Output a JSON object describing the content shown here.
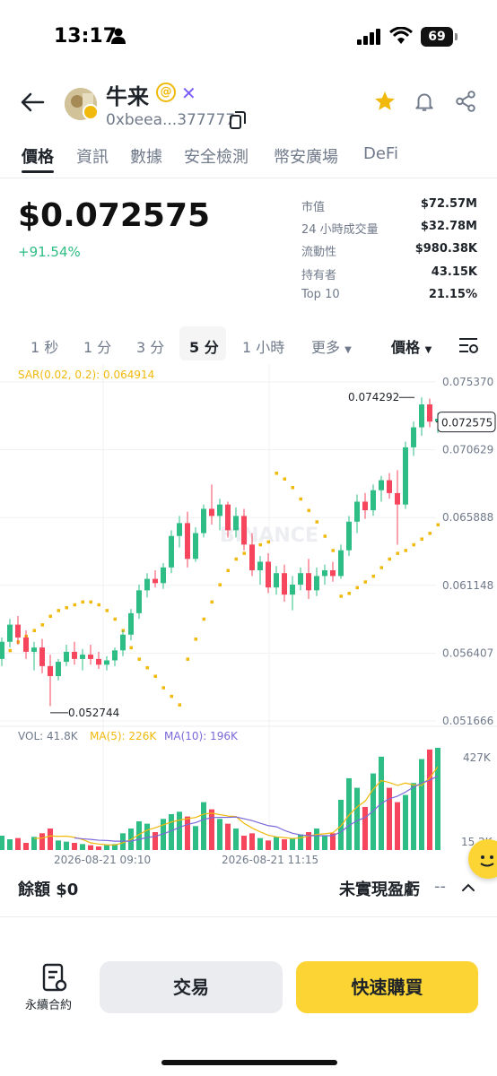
{
  "status_bar": {
    "time": "13:17",
    "battery": "69"
  },
  "token": {
    "name": "牛来",
    "address": "0xbeea...377777"
  },
  "tabs": [
    "價格",
    "資訊",
    "數據",
    "安全檢測",
    "幣安廣場",
    "DeFi"
  ],
  "price": {
    "value": "$0.072575",
    "change": "+91.54%"
  },
  "stats": [
    {
      "label": "市值",
      "value": "$72.57M"
    },
    {
      "label": "24 小時成交量",
      "value": "$32.78M"
    },
    {
      "label": "流動性",
      "value": "$980.38K"
    },
    {
      "label": "持有者",
      "value": "43.15K"
    },
    {
      "label": "Top 10",
      "value": "21.15%"
    }
  ],
  "timeframes": [
    "1 秒",
    "1 分",
    "3 分",
    "5 分",
    "1 小時",
    "更多"
  ],
  "active_timeframe": "5 分",
  "chart_type_label": "價格",
  "chart_data": {
    "type": "candlestick",
    "indicator_label": "SAR(0.02, 0.2): 0.064914",
    "y_ticks": [
      "0.075370",
      "0.070629",
      "0.065888",
      "0.061148",
      "0.056407",
      "0.051666"
    ],
    "ylim": [
      0.051666,
      0.07537
    ],
    "current_price": "0.072575",
    "high_label": "0.074292",
    "low_label": "0.052744",
    "watermark": "BINANCE",
    "volume_labels": {
      "vol": "VOL: 41.8K",
      "ma5": "MA(5): 226K",
      "ma10": "MA(10): 196K"
    },
    "volume_ticks": [
      "427K",
      "15.2K"
    ],
    "x_ticks": [
      "2026-08-21 09:10",
      "2026-08-21 11:15"
    ],
    "candles": [
      {
        "o": 0.056,
        "h": 0.0575,
        "l": 0.0555,
        "c": 0.0572
      },
      {
        "o": 0.0572,
        "h": 0.0588,
        "l": 0.0568,
        "c": 0.0584
      },
      {
        "o": 0.0584,
        "h": 0.059,
        "l": 0.057,
        "c": 0.0575
      },
      {
        "o": 0.0575,
        "h": 0.058,
        "l": 0.056,
        "c": 0.0565
      },
      {
        "o": 0.0565,
        "h": 0.0572,
        "l": 0.0552,
        "c": 0.0568
      },
      {
        "o": 0.0568,
        "h": 0.0574,
        "l": 0.055,
        "c": 0.0555
      },
      {
        "o": 0.0555,
        "h": 0.0563,
        "l": 0.0527,
        "c": 0.0548
      },
      {
        "o": 0.0548,
        "h": 0.056,
        "l": 0.0545,
        "c": 0.0558
      },
      {
        "o": 0.0558,
        "h": 0.057,
        "l": 0.0555,
        "c": 0.0565
      },
      {
        "o": 0.0565,
        "h": 0.0572,
        "l": 0.0556,
        "c": 0.056
      },
      {
        "o": 0.056,
        "h": 0.0567,
        "l": 0.0552,
        "c": 0.0563
      },
      {
        "o": 0.0563,
        "h": 0.057,
        "l": 0.0556,
        "c": 0.056
      },
      {
        "o": 0.056,
        "h": 0.0565,
        "l": 0.0553,
        "c": 0.0556
      },
      {
        "o": 0.0556,
        "h": 0.0562,
        "l": 0.0552,
        "c": 0.0559
      },
      {
        "o": 0.0559,
        "h": 0.0568,
        "l": 0.0555,
        "c": 0.0566
      },
      {
        "o": 0.0566,
        "h": 0.058,
        "l": 0.0562,
        "c": 0.0577
      },
      {
        "o": 0.0577,
        "h": 0.0595,
        "l": 0.0573,
        "c": 0.0592
      },
      {
        "o": 0.0592,
        "h": 0.0612,
        "l": 0.0588,
        "c": 0.0608
      },
      {
        "o": 0.0608,
        "h": 0.062,
        "l": 0.0603,
        "c": 0.0616
      },
      {
        "o": 0.0616,
        "h": 0.0622,
        "l": 0.061,
        "c": 0.0613
      },
      {
        "o": 0.0613,
        "h": 0.0627,
        "l": 0.0609,
        "c": 0.0624
      },
      {
        "o": 0.0624,
        "h": 0.065,
        "l": 0.062,
        "c": 0.0646
      },
      {
        "o": 0.0646,
        "h": 0.066,
        "l": 0.0638,
        "c": 0.0655
      },
      {
        "o": 0.0655,
        "h": 0.0663,
        "l": 0.0624,
        "c": 0.063
      },
      {
        "o": 0.063,
        "h": 0.0652,
        "l": 0.0628,
        "c": 0.0648
      },
      {
        "o": 0.0648,
        "h": 0.0668,
        "l": 0.0645,
        "c": 0.0665
      },
      {
        "o": 0.0665,
        "h": 0.0682,
        "l": 0.0654,
        "c": 0.066
      },
      {
        "o": 0.066,
        "h": 0.0672,
        "l": 0.065,
        "c": 0.0668
      },
      {
        "o": 0.0668,
        "h": 0.067,
        "l": 0.0645,
        "c": 0.065
      },
      {
        "o": 0.065,
        "h": 0.0666,
        "l": 0.0645,
        "c": 0.066
      },
      {
        "o": 0.066,
        "h": 0.0665,
        "l": 0.0636,
        "c": 0.064
      },
      {
        "o": 0.064,
        "h": 0.0648,
        "l": 0.0618,
        "c": 0.0622
      },
      {
        "o": 0.0622,
        "h": 0.0632,
        "l": 0.0612,
        "c": 0.0628
      },
      {
        "o": 0.0628,
        "h": 0.0634,
        "l": 0.0606,
        "c": 0.061
      },
      {
        "o": 0.061,
        "h": 0.0625,
        "l": 0.0605,
        "c": 0.062
      },
      {
        "o": 0.062,
        "h": 0.0626,
        "l": 0.06,
        "c": 0.0605
      },
      {
        "o": 0.0605,
        "h": 0.0618,
        "l": 0.0594,
        "c": 0.0612
      },
      {
        "o": 0.0612,
        "h": 0.0624,
        "l": 0.0608,
        "c": 0.062
      },
      {
        "o": 0.062,
        "h": 0.063,
        "l": 0.0602,
        "c": 0.0608
      },
      {
        "o": 0.0608,
        "h": 0.0624,
        "l": 0.0604,
        "c": 0.0618
      },
      {
        "o": 0.0618,
        "h": 0.0626,
        "l": 0.0612,
        "c": 0.0622
      },
      {
        "o": 0.0622,
        "h": 0.0628,
        "l": 0.0614,
        "c": 0.0618
      },
      {
        "o": 0.0618,
        "h": 0.064,
        "l": 0.0616,
        "c": 0.0636
      },
      {
        "o": 0.0636,
        "h": 0.066,
        "l": 0.0632,
        "c": 0.0656
      },
      {
        "o": 0.0656,
        "h": 0.0675,
        "l": 0.0648,
        "c": 0.067
      },
      {
        "o": 0.067,
        "h": 0.0676,
        "l": 0.0658,
        "c": 0.0664
      },
      {
        "o": 0.0664,
        "h": 0.0682,
        "l": 0.066,
        "c": 0.0678
      },
      {
        "o": 0.0678,
        "h": 0.0688,
        "l": 0.067,
        "c": 0.0685
      },
      {
        "o": 0.0685,
        "h": 0.069,
        "l": 0.0672,
        "c": 0.0676
      },
      {
        "o": 0.0676,
        "h": 0.0692,
        "l": 0.064,
        "c": 0.0668
      },
      {
        "o": 0.0668,
        "h": 0.0712,
        "l": 0.0665,
        "c": 0.0708
      },
      {
        "o": 0.0708,
        "h": 0.0726,
        "l": 0.0702,
        "c": 0.0722
      },
      {
        "o": 0.0722,
        "h": 0.0743,
        "l": 0.0716,
        "c": 0.0738
      },
      {
        "o": 0.0738,
        "h": 0.0742,
        "l": 0.0722,
        "c": 0.0726
      },
      {
        "o": 0.0726,
        "h": 0.0732,
        "l": 0.0718,
        "c": 0.0728
      }
    ],
    "volumes": [
      60,
      45,
      50,
      30,
      55,
      70,
      90,
      40,
      35,
      30,
      25,
      20,
      15,
      20,
      25,
      70,
      90,
      120,
      110,
      75,
      130,
      150,
      160,
      140,
      100,
      200,
      170,
      130,
      110,
      90,
      60,
      70,
      50,
      40,
      55,
      45,
      50,
      65,
      75,
      90,
      60,
      70,
      210,
      300,
      260,
      180,
      320,
      390,
      260,
      200,
      230,
      280,
      380,
      420,
      427
    ],
    "sar_points": [
      [
        1,
        0.0562
      ],
      [
        2,
        0.0566
      ],
      [
        3,
        0.0572
      ],
      [
        4,
        0.0576
      ],
      [
        5,
        0.058
      ],
      [
        6,
        0.0584
      ],
      [
        7,
        0.059
      ],
      [
        8,
        0.0594
      ],
      [
        9,
        0.0596
      ],
      [
        10,
        0.0598
      ],
      [
        11,
        0.06
      ],
      [
        12,
        0.06
      ],
      [
        13,
        0.0598
      ],
      [
        14,
        0.0594
      ],
      [
        15,
        0.0588
      ],
      [
        16,
        0.058
      ],
      [
        17,
        0.0568
      ],
      [
        18,
        0.056
      ],
      [
        19,
        0.0554
      ],
      [
        20,
        0.0548
      ],
      [
        21,
        0.054
      ],
      [
        22,
        0.0534
      ],
      [
        23,
        0.0528
      ],
      [
        24,
        0.056
      ],
      [
        25,
        0.0574
      ],
      [
        26,
        0.0588
      ],
      [
        27,
        0.06
      ],
      [
        28,
        0.0612
      ],
      [
        29,
        0.0622
      ],
      [
        30,
        0.063
      ],
      [
        31,
        0.0634
      ],
      [
        32,
        0.0638
      ],
      [
        33,
        0.064
      ],
      [
        34,
        0.0642
      ],
      [
        35,
        0.069
      ],
      [
        36,
        0.0686
      ],
      [
        37,
        0.068
      ],
      [
        38,
        0.0672
      ],
      [
        39,
        0.0664
      ],
      [
        40,
        0.0656
      ],
      [
        41,
        0.0646
      ],
      [
        42,
        0.0636
      ],
      [
        43,
        0.0604
      ],
      [
        44,
        0.0606
      ],
      [
        45,
        0.061
      ],
      [
        46,
        0.0614
      ],
      [
        47,
        0.0618
      ],
      [
        48,
        0.0624
      ],
      [
        49,
        0.063
      ],
      [
        50,
        0.0634
      ],
      [
        51,
        0.0636
      ],
      [
        52,
        0.064
      ],
      [
        53,
        0.0644
      ],
      [
        54,
        0.0648
      ],
      [
        55,
        0.0654
      ]
    ]
  },
  "balance": "餘額 $0",
  "unrealized_label": "未實現盈虧",
  "unrealized_value": "--",
  "bottom": {
    "perp_label": "永續合約",
    "trade": "交易",
    "quick_buy": "快速購買"
  },
  "colors": {
    "up": "#2ebd85",
    "down": "#f6465d",
    "sar": "#f0b90b",
    "ma5": "#f0b90b",
    "ma10": "#7b68d9",
    "accent": "#fcd535"
  }
}
